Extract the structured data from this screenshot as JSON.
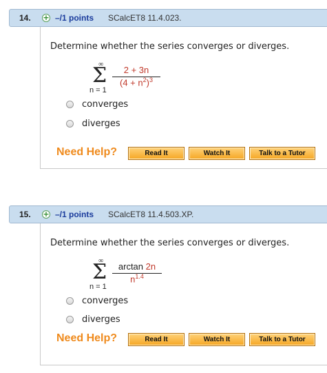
{
  "questions": [
    {
      "number": "14.",
      "points": "–/1 points",
      "reference": "SCalcET8 11.4.023.",
      "prompt": "Determine whether the series converges or diverges.",
      "series": {
        "upper": "∞",
        "lower": "n = 1",
        "numerator": "2 + 3n",
        "denominator_base": "(4 + n",
        "denominator_inner_exp": "2",
        "denominator_close": ")",
        "denominator_exp": "3"
      },
      "options": [
        "converges",
        "diverges"
      ],
      "need_help": "Need Help?",
      "buttons": [
        "Read It",
        "Watch It",
        "Talk to a Tutor"
      ]
    },
    {
      "number": "15.",
      "points": "–/1 points",
      "reference": "SCalcET8 11.4.503.XP.",
      "prompt": "Determine whether the series converges or diverges.",
      "series": {
        "upper": "∞",
        "lower": "n = 1",
        "numerator_fn": "arctan ",
        "numerator_arg": "2n",
        "denominator_base": "n",
        "denominator_exp": "1.4"
      },
      "options": [
        "converges",
        "diverges"
      ],
      "need_help": "Need Help?",
      "buttons": [
        "Read It",
        "Watch It",
        "Talk to a Tutor"
      ]
    }
  ],
  "colors": {
    "header_bg": "#c9ddef",
    "points_text": "#1a3b9c",
    "need_help": "#ef8a1c",
    "button_fill": "#f5a623",
    "math_red": "#c0392b"
  },
  "icons": [
    "plus-icon",
    "radio-unchecked"
  ]
}
